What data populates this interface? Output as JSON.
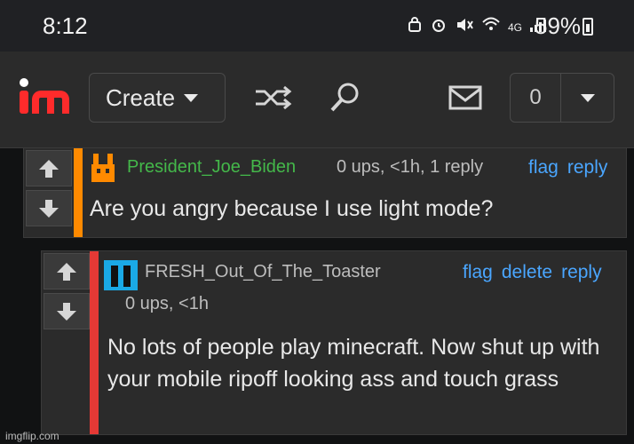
{
  "status_bar": {
    "time": "8:12",
    "network": "4G",
    "battery": "59%"
  },
  "topbar": {
    "create_label": "Create",
    "notification_count": "0"
  },
  "comments": [
    {
      "username": "President_Joe_Biden",
      "meta": "0 ups, <1h, 1 reply",
      "actions": [
        "flag",
        "reply"
      ],
      "text": "Are you angry because I use light mode?"
    },
    {
      "username": "FRESH_Out_Of_The_Toaster",
      "meta": "0 ups, <1h",
      "actions": [
        "flag",
        "delete",
        "reply"
      ],
      "text": "No lots of people play minecraft. Now shut up with your mobile ripoff looking ass and touch grass"
    }
  ],
  "watermark": "imgflip.com",
  "colors": {
    "accent_red": "#ff2b2b",
    "link_blue": "#4aa6ff",
    "username_green": "#44b84a",
    "stripe_orange": "#ff8a00",
    "stripe_red": "#e53935",
    "avatar_blue": "#1aa9e6"
  }
}
